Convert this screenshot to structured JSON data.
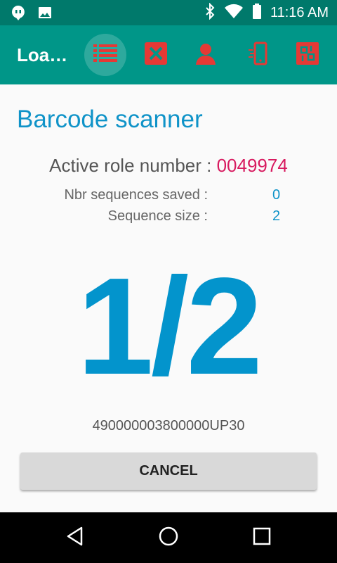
{
  "status_bar": {
    "time": "11:16 AM",
    "left_icons": [
      "chat-notification-icon",
      "image-notification-icon"
    ],
    "right_icons": [
      "bluetooth-icon",
      "wifi-icon",
      "battery-icon"
    ]
  },
  "toolbar": {
    "title": "Loa…",
    "actions": [
      "list-icon",
      "close-box-icon",
      "person-icon",
      "phone-vibrate-icon",
      "pallet-icon"
    ],
    "colors": {
      "bar": "#009688",
      "icon": "#e53935"
    }
  },
  "main": {
    "title": "Barcode scanner",
    "role_label": "Active role number : ",
    "role_value": "0049974",
    "rows": [
      {
        "label": "Nbr sequences saved :",
        "value": "0"
      },
      {
        "label": "Sequence size :",
        "value": "2"
      }
    ],
    "progress": "1/2",
    "barcode": "490000003800000UP30",
    "cancel_label": "CANCEL"
  },
  "nav_bar": {
    "icons": [
      "back-icon",
      "home-icon",
      "recents-icon"
    ]
  }
}
